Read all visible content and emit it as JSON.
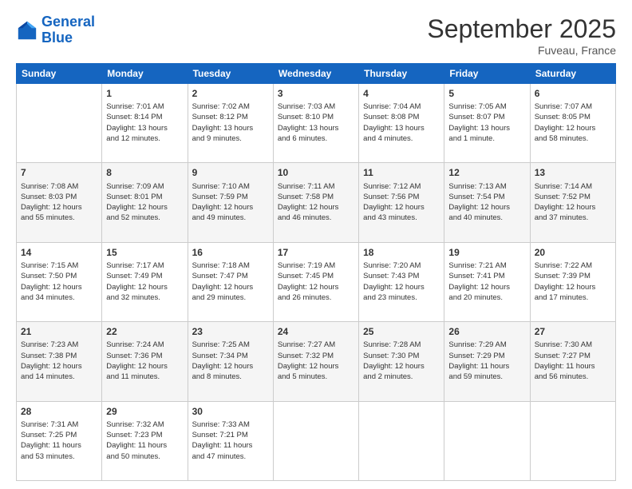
{
  "logo": {
    "line1": "General",
    "line2": "Blue"
  },
  "title": "September 2025",
  "subtitle": "Fuveau, France",
  "days_of_week": [
    "Sunday",
    "Monday",
    "Tuesday",
    "Wednesday",
    "Thursday",
    "Friday",
    "Saturday"
  ],
  "weeks": [
    [
      {
        "num": "",
        "info": ""
      },
      {
        "num": "1",
        "info": "Sunrise: 7:01 AM\nSunset: 8:14 PM\nDaylight: 13 hours\nand 12 minutes."
      },
      {
        "num": "2",
        "info": "Sunrise: 7:02 AM\nSunset: 8:12 PM\nDaylight: 13 hours\nand 9 minutes."
      },
      {
        "num": "3",
        "info": "Sunrise: 7:03 AM\nSunset: 8:10 PM\nDaylight: 13 hours\nand 6 minutes."
      },
      {
        "num": "4",
        "info": "Sunrise: 7:04 AM\nSunset: 8:08 PM\nDaylight: 13 hours\nand 4 minutes."
      },
      {
        "num": "5",
        "info": "Sunrise: 7:05 AM\nSunset: 8:07 PM\nDaylight: 13 hours\nand 1 minute."
      },
      {
        "num": "6",
        "info": "Sunrise: 7:07 AM\nSunset: 8:05 PM\nDaylight: 12 hours\nand 58 minutes."
      }
    ],
    [
      {
        "num": "7",
        "info": "Sunrise: 7:08 AM\nSunset: 8:03 PM\nDaylight: 12 hours\nand 55 minutes."
      },
      {
        "num": "8",
        "info": "Sunrise: 7:09 AM\nSunset: 8:01 PM\nDaylight: 12 hours\nand 52 minutes."
      },
      {
        "num": "9",
        "info": "Sunrise: 7:10 AM\nSunset: 7:59 PM\nDaylight: 12 hours\nand 49 minutes."
      },
      {
        "num": "10",
        "info": "Sunrise: 7:11 AM\nSunset: 7:58 PM\nDaylight: 12 hours\nand 46 minutes."
      },
      {
        "num": "11",
        "info": "Sunrise: 7:12 AM\nSunset: 7:56 PM\nDaylight: 12 hours\nand 43 minutes."
      },
      {
        "num": "12",
        "info": "Sunrise: 7:13 AM\nSunset: 7:54 PM\nDaylight: 12 hours\nand 40 minutes."
      },
      {
        "num": "13",
        "info": "Sunrise: 7:14 AM\nSunset: 7:52 PM\nDaylight: 12 hours\nand 37 minutes."
      }
    ],
    [
      {
        "num": "14",
        "info": "Sunrise: 7:15 AM\nSunset: 7:50 PM\nDaylight: 12 hours\nand 34 minutes."
      },
      {
        "num": "15",
        "info": "Sunrise: 7:17 AM\nSunset: 7:49 PM\nDaylight: 12 hours\nand 32 minutes."
      },
      {
        "num": "16",
        "info": "Sunrise: 7:18 AM\nSunset: 7:47 PM\nDaylight: 12 hours\nand 29 minutes."
      },
      {
        "num": "17",
        "info": "Sunrise: 7:19 AM\nSunset: 7:45 PM\nDaylight: 12 hours\nand 26 minutes."
      },
      {
        "num": "18",
        "info": "Sunrise: 7:20 AM\nSunset: 7:43 PM\nDaylight: 12 hours\nand 23 minutes."
      },
      {
        "num": "19",
        "info": "Sunrise: 7:21 AM\nSunset: 7:41 PM\nDaylight: 12 hours\nand 20 minutes."
      },
      {
        "num": "20",
        "info": "Sunrise: 7:22 AM\nSunset: 7:39 PM\nDaylight: 12 hours\nand 17 minutes."
      }
    ],
    [
      {
        "num": "21",
        "info": "Sunrise: 7:23 AM\nSunset: 7:38 PM\nDaylight: 12 hours\nand 14 minutes."
      },
      {
        "num": "22",
        "info": "Sunrise: 7:24 AM\nSunset: 7:36 PM\nDaylight: 12 hours\nand 11 minutes."
      },
      {
        "num": "23",
        "info": "Sunrise: 7:25 AM\nSunset: 7:34 PM\nDaylight: 12 hours\nand 8 minutes."
      },
      {
        "num": "24",
        "info": "Sunrise: 7:27 AM\nSunset: 7:32 PM\nDaylight: 12 hours\nand 5 minutes."
      },
      {
        "num": "25",
        "info": "Sunrise: 7:28 AM\nSunset: 7:30 PM\nDaylight: 12 hours\nand 2 minutes."
      },
      {
        "num": "26",
        "info": "Sunrise: 7:29 AM\nSunset: 7:29 PM\nDaylight: 11 hours\nand 59 minutes."
      },
      {
        "num": "27",
        "info": "Sunrise: 7:30 AM\nSunset: 7:27 PM\nDaylight: 11 hours\nand 56 minutes."
      }
    ],
    [
      {
        "num": "28",
        "info": "Sunrise: 7:31 AM\nSunset: 7:25 PM\nDaylight: 11 hours\nand 53 minutes."
      },
      {
        "num": "29",
        "info": "Sunrise: 7:32 AM\nSunset: 7:23 PM\nDaylight: 11 hours\nand 50 minutes."
      },
      {
        "num": "30",
        "info": "Sunrise: 7:33 AM\nSunset: 7:21 PM\nDaylight: 11 hours\nand 47 minutes."
      },
      {
        "num": "",
        "info": ""
      },
      {
        "num": "",
        "info": ""
      },
      {
        "num": "",
        "info": ""
      },
      {
        "num": "",
        "info": ""
      }
    ]
  ]
}
